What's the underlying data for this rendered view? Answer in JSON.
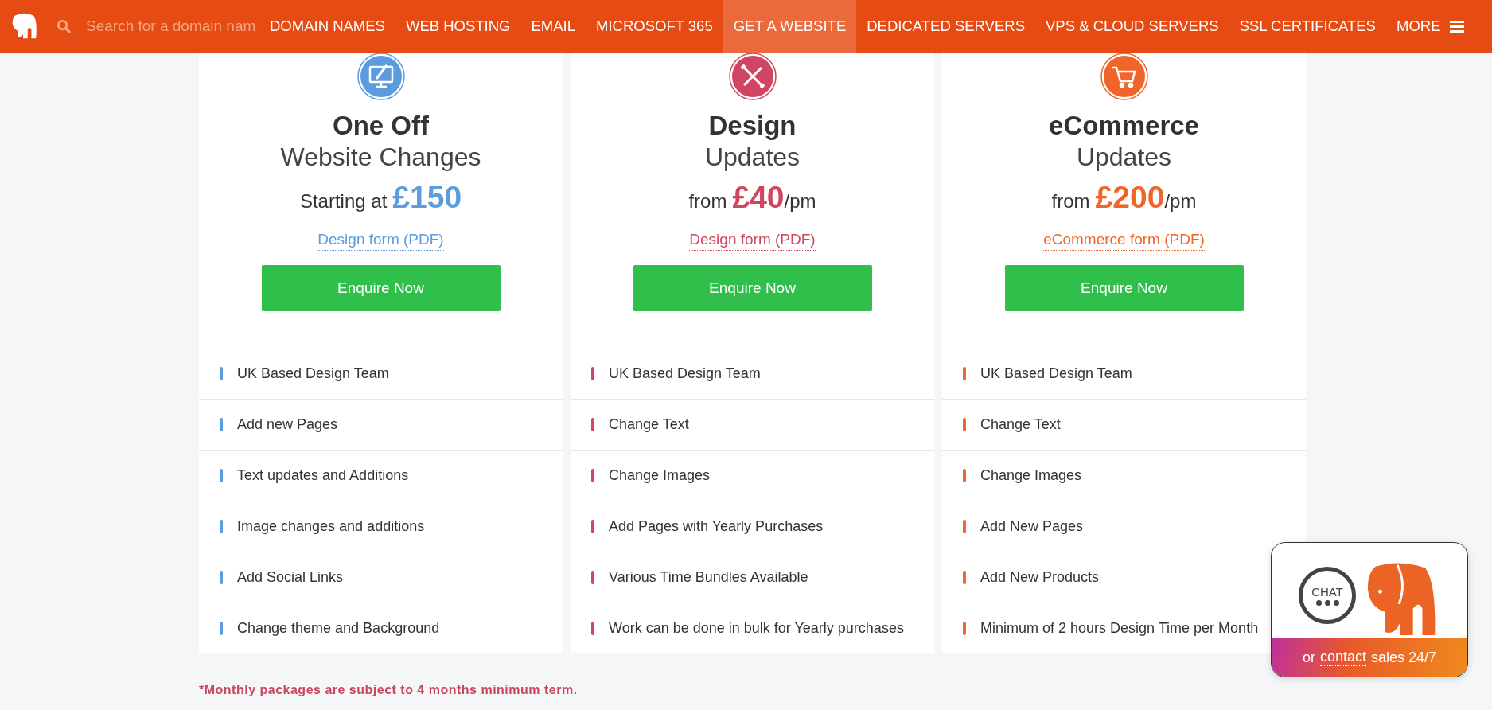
{
  "nav": {
    "search": {
      "placeholder": "Search for a domain nam"
    },
    "items": [
      {
        "label": "DOMAIN NAMES",
        "selected": false
      },
      {
        "label": "WEB HOSTING",
        "selected": false
      },
      {
        "label": "EMAIL",
        "selected": false
      },
      {
        "label": "MICROSOFT 365",
        "selected": false
      },
      {
        "label": "GET A WEBSITE",
        "selected": true
      },
      {
        "label": "DEDICATED SERVERS",
        "selected": false
      },
      {
        "label": "VPS & CLOUD SERVERS",
        "selected": false
      },
      {
        "label": "SSL CERTIFICATES",
        "selected": false
      }
    ],
    "more": "MORE"
  },
  "plans": [
    {
      "kind": "monitor",
      "color": "#5b9be0",
      "title": "One Off",
      "subtitle": "Website Changes",
      "price_prefix": "Starting at",
      "price": "£150",
      "link": "Design form (PDF)",
      "button": "Enquire Now",
      "features": [
        "UK Based Design Team",
        "Add new Pages",
        "Text updates and Additions",
        "Image changes and additions",
        "Add Social Links",
        "Change theme and Background"
      ]
    },
    {
      "kind": "tools",
      "color": "#d0455f",
      "title": "Design",
      "subtitle": "Updates",
      "price_prefix": "from",
      "price": "£40",
      "price_suffix": "/pm",
      "link": "Design form (PDF)",
      "button": "Enquire Now",
      "features": [
        "UK Based Design Team",
        "Change Text",
        "Change Images",
        "Add Pages with Yearly Purchases",
        "Various Time Bundles Available",
        "Work can be done in bulk for Yearly purchases"
      ]
    },
    {
      "kind": "cart",
      "color": "#f0662a",
      "title": "eCommerce",
      "subtitle": "Updates",
      "price_prefix": "from",
      "price": "£200",
      "price_suffix": "/pm",
      "link": "eCommerce form (PDF)",
      "button": "Enquire Now",
      "features": [
        "UK Based Design Team",
        "Change Text",
        "Change Images",
        "Add New Pages",
        "Add New Products",
        "Minimum of 2 hours Design Time per Month"
      ]
    }
  ],
  "footnote": "*Monthly packages are subject to 4 months minimum term.",
  "chat": {
    "badge": "CHAT",
    "footer_prefix": "or",
    "footer_link": "contact",
    "footer_suffix": "sales 24/7"
  }
}
